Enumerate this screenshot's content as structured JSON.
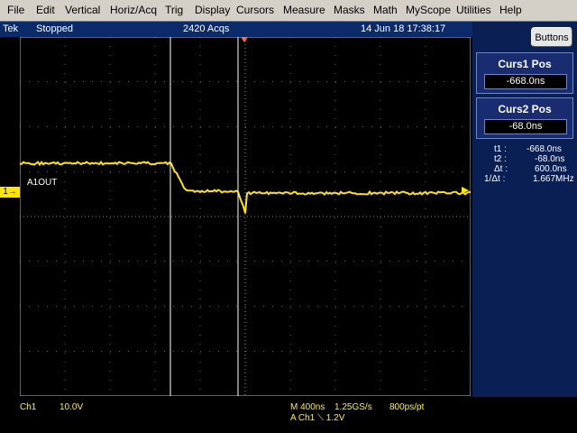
{
  "menu": [
    "File",
    "Edit",
    "Vertical",
    "Horiz/Acq",
    "Trig",
    "Display",
    "Cursors",
    "Measure",
    "Masks",
    "Math",
    "MyScope",
    "Utilities",
    "Help"
  ],
  "status": {
    "brand": "Tek",
    "state": "Stopped",
    "acqs": "2420 Acqs",
    "datetime": "14 Jun 18 17:38:17"
  },
  "buttons_label": "Buttons",
  "curs1": {
    "title": "Curs1 Pos",
    "value": "-668.0ns"
  },
  "curs2": {
    "title": "Curs2 Pos",
    "value": "-68.0ns"
  },
  "readouts": [
    {
      "label": "t1 :",
      "value": "-668.0ns"
    },
    {
      "label": "t2 :",
      "value": "-68.0ns"
    },
    {
      "label": "Δt :",
      "value": "600.0ns"
    },
    {
      "label": "1/Δt :",
      "value": "1.667MHz"
    }
  ],
  "channel": {
    "marker": "1",
    "label": "A1OUT",
    "name": "Ch1",
    "scale": "10.0V"
  },
  "horizontal": {
    "timebase": "M 400ns",
    "rate": "1.25GS/s",
    "resolution": "800ps/pt"
  },
  "trigger": {
    "summary": "A  Ch1  ⟍  1.2V"
  },
  "colors": {
    "trace": "#ffe600",
    "cursor": "#ffffff",
    "grid": "#bdbdbd",
    "panel": "#0a1f54"
  }
}
